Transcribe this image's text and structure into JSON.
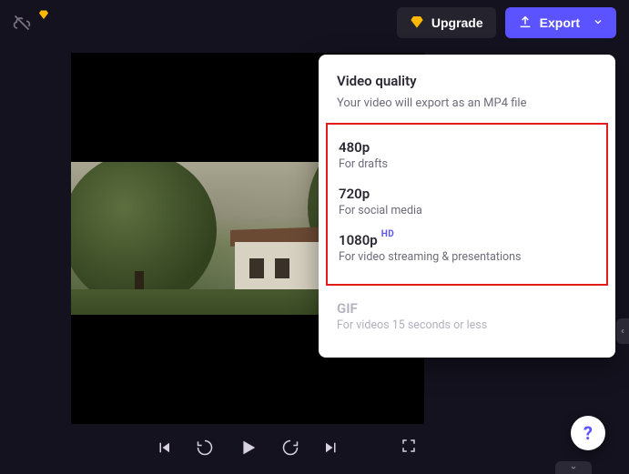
{
  "header": {
    "upgrade_label": "Upgrade",
    "export_label": "Export"
  },
  "export_popover": {
    "title": "Video quality",
    "subtitle": "Your video will export as an MP4 file",
    "options": [
      {
        "label": "480p",
        "desc": "For drafts",
        "badge": ""
      },
      {
        "label": "720p",
        "desc": "For social media",
        "badge": ""
      },
      {
        "label": "1080p",
        "desc": "For video streaming & presentations",
        "badge": "HD"
      }
    ],
    "disabled_option": {
      "label": "GIF",
      "desc": "For videos 15 seconds or less"
    }
  },
  "help": {
    "glyph": "?"
  }
}
